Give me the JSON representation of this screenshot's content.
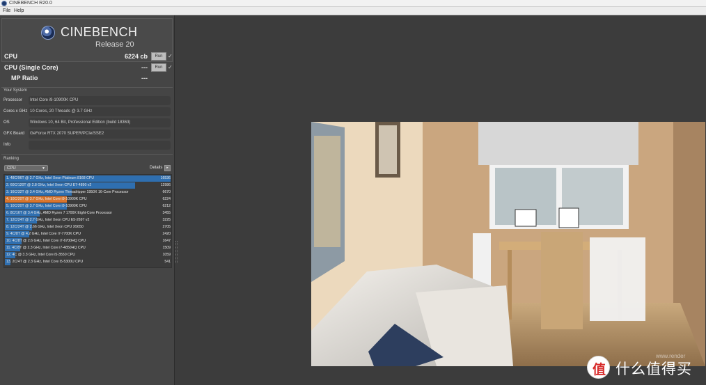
{
  "window": {
    "title": "CINEBENCH R20.0"
  },
  "menu": {
    "file": "File",
    "help": "Help"
  },
  "logo": {
    "name": "CINEBENCH",
    "release": "Release 20"
  },
  "scores": {
    "cpu": {
      "label": "CPU",
      "value": "6224 cb",
      "run": "Run"
    },
    "single": {
      "label": "CPU (Single Core)",
      "value": "---",
      "run": "Run"
    },
    "mp": {
      "label": "MP Ratio",
      "value": "---"
    }
  },
  "system": {
    "title": "Your System",
    "rows": [
      {
        "label": "Processor",
        "value": "Intel Core i9-10900K CPU"
      },
      {
        "label": "Cores x GHz",
        "value": "10 Cores, 20 Threads @ 3.7 GHz"
      },
      {
        "label": "OS",
        "value": "Windows 10, 64 Bit, Professional Edition (build 18363)"
      },
      {
        "label": "GFX Board",
        "value": "GeForce RTX 2070 SUPER/PCIe/SSE2"
      },
      {
        "label": "Info",
        "value": ""
      }
    ]
  },
  "ranking": {
    "title": "Ranking",
    "filter": "CPU",
    "details": "Details",
    "rows": [
      {
        "text": "1. 48C/96T @ 2.7 GHz, Intel Xeon Platinum 8168 CPU",
        "score": "16536",
        "fraction": 1.0,
        "color": "#2f6fb0"
      },
      {
        "text": "2. 60C/120T @ 2.8 GHz, Intel Xeon CPU E7-4890 v2",
        "score": "12986",
        "fraction": 0.785,
        "color": "#2f6fb0"
      },
      {
        "text": "3. 16C/32T @ 3.4 GHz, AMD Ryzen Threadripper 1950X 16-Core Processor",
        "score": "6670",
        "fraction": 0.403,
        "color": "#2f6fb0"
      },
      {
        "text": "4. 10C/20T @ 3.7 GHz, Intel Core i9-10900K CPU",
        "score": "6224",
        "fraction": 0.376,
        "color": "#d9752d"
      },
      {
        "text": "5. 10C/20T @ 3.7 GHz, Intel Core i9-10900K CPU",
        "score": "6212",
        "fraction": 0.376,
        "color": "#2f6fb0"
      },
      {
        "text": "6. 8C/16T @ 3.4 GHz, AMD Ryzen 7 1700X Eight-Core Processor",
        "score": "3455",
        "fraction": 0.209,
        "color": "#2f6fb0"
      },
      {
        "text": "7. 12C/24T @ 2.7 GHz, Intel Xeon CPU E5-2697 v2",
        "score": "3225",
        "fraction": 0.195,
        "color": "#2f6fb0"
      },
      {
        "text": "8. 12C/24T @ 2.66 GHz, Intel Xeon CPU X5650",
        "score": "2705",
        "fraction": 0.164,
        "color": "#2f6fb0"
      },
      {
        "text": "9. 4C/8T @ 4.2 GHz, Intel Core i7-7700K CPU",
        "score": "2420",
        "fraction": 0.146,
        "color": "#2f6fb0"
      },
      {
        "text": "10. 4C/8T @ 2.6 GHz, Intel Core i7-6700HQ CPU",
        "score": "1647",
        "fraction": 0.1,
        "color": "#2f6fb0"
      },
      {
        "text": "11. 4C/8T @ 2.3 GHz, Intel Core i7-4850HQ CPU",
        "score": "1509",
        "fraction": 0.091,
        "color": "#2f6fb0"
      },
      {
        "text": "12. 4C @ 3.3 GHz, Intel Core i5-3550 CPU",
        "score": "1059",
        "fraction": 0.064,
        "color": "#2f6fb0"
      },
      {
        "text": "13. 2C/4T @ 2.3 GHz, Intel Core i5-5300U CPU",
        "score": "541",
        "fraction": 0.033,
        "color": "#2f6fb0"
      }
    ]
  },
  "watermark": {
    "text": "什么值得买",
    "glyph": "值",
    "render_mark": "www.render"
  }
}
